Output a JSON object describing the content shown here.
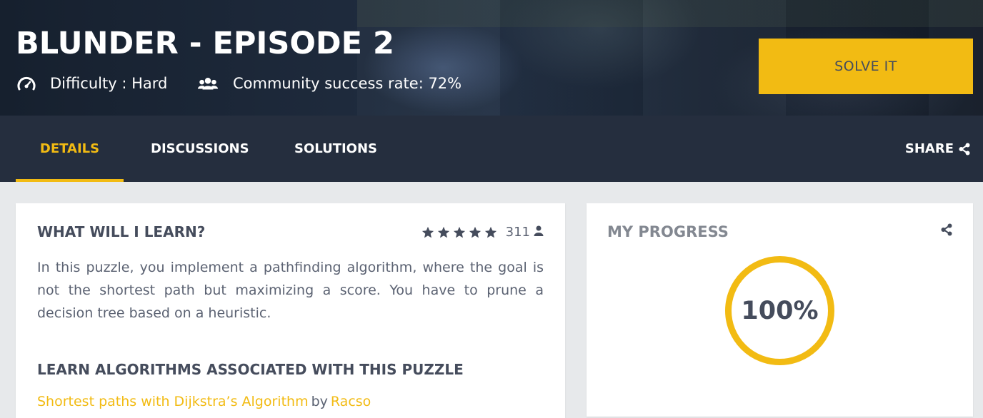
{
  "hero": {
    "title": "BLUNDER - EPISODE 2",
    "difficulty_text": "Difficulty : Hard",
    "difficulty_icon": "gauge-icon",
    "success_text": "Community success rate: 72%",
    "success_icon": "users-icon",
    "solve_label": "SOLVE IT"
  },
  "nav": {
    "tabs": [
      {
        "label": "DETAILS",
        "active": true
      },
      {
        "label": "DISCUSSIONS",
        "active": false
      },
      {
        "label": "SOLUTIONS",
        "active": false
      }
    ],
    "share_label": "SHARE",
    "share_icon": "share-icon"
  },
  "learn": {
    "heading": "WHAT WILL I LEARN?",
    "rating_stars": 5,
    "rating_count": "311",
    "rating_icon": "user-icon",
    "description": "In this puzzle, you implement a pathfinding algorithm, where the goal is not the shortest path but maximizing a score. You have to prune a decision tree based on a heuristic.",
    "algorithms_heading": "LEARN ALGORITHMS ASSOCIATED WITH THIS PUZZLE",
    "algorithm_link": "Shortest paths with Dijkstra’s Algorithm",
    "algorithm_by": "by",
    "algorithm_author": "Racso"
  },
  "progress": {
    "heading": "MY PROGRESS",
    "value": "100%",
    "percent": 100,
    "share_icon": "share-icon"
  },
  "colors": {
    "accent": "#f2bb13",
    "nav_bg": "#252e3e",
    "page_bg": "#e7e9eb",
    "text_dark": "#454c5c"
  }
}
